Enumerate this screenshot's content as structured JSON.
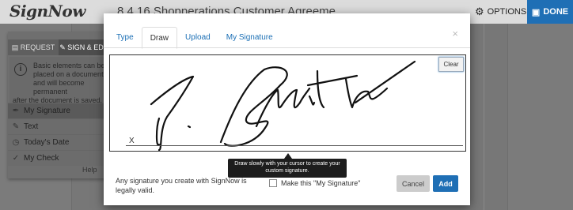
{
  "app": {
    "logo": "SignNow",
    "document_title": "8.4.16 Shopperations Customer Agreeme..."
  },
  "toolbar": {
    "options_label": "OPTIONS",
    "options_icon": "gear-icon",
    "done_label": "DONE",
    "done_icon": "save-icon",
    "accent": "#1f6fb5"
  },
  "sidebar": {
    "tabs": [
      {
        "label": "REQUEST",
        "icon": "request-icon"
      },
      {
        "label": "SIGN & EDIT",
        "icon": "pencil-icon"
      }
    ],
    "info_text_1": "Basic elements can be placed on a document and will become permanent",
    "info_text_2": "after the document is saved.",
    "items": [
      {
        "label": "My Signature",
        "icon": "pen-nib-icon"
      },
      {
        "label": "Text",
        "icon": "pencil-icon"
      },
      {
        "label": "Today's Date",
        "icon": "clock-icon"
      },
      {
        "label": "My Check",
        "icon": "check-icon"
      }
    ],
    "help_label": "Help"
  },
  "modal": {
    "tabs": [
      "Type",
      "Draw",
      "Upload",
      "My Signature"
    ],
    "active_tab": "Draw",
    "close_label": "×",
    "clear_label": "Clear",
    "signature_x": "X",
    "tooltip": "Draw slowly with your cursor to create your custom signature.",
    "legal_text": "Any signature you create with SignNow is legally valid.",
    "checkbox_label": "Make this \"My Signature\"",
    "cancel_label": "Cancel",
    "add_label": "Add"
  }
}
